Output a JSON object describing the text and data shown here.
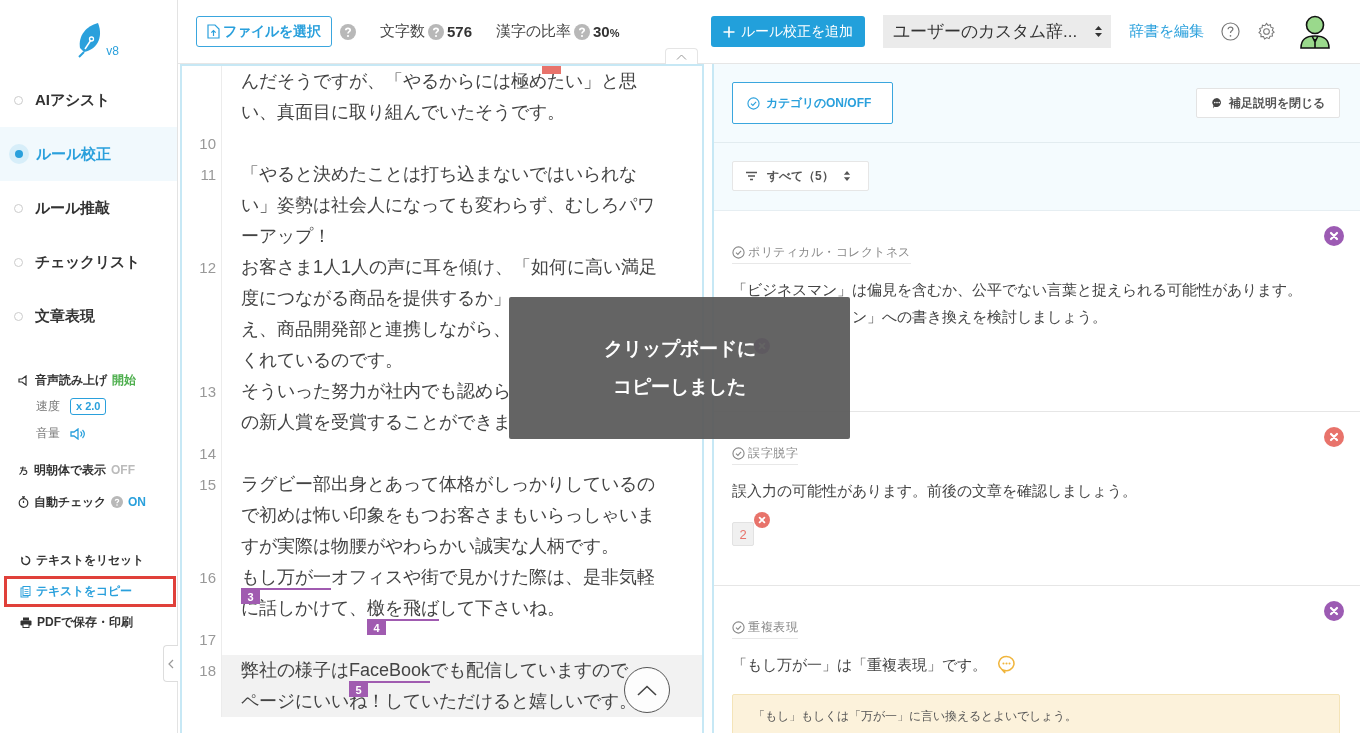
{
  "logo": {
    "version": "v8"
  },
  "nav": [
    {
      "label": "AIアシスト",
      "selected": false
    },
    {
      "label": "ルール校正",
      "selected": true
    },
    {
      "label": "ルール推敲",
      "selected": false
    },
    {
      "label": "チェックリスト",
      "selected": false
    },
    {
      "label": "文章表現",
      "selected": false
    }
  ],
  "speech": {
    "label": "音声読み上げ",
    "action": "開始",
    "speed_label": "速度",
    "speed": "x 2.0",
    "volume_label": "音量"
  },
  "toggles": [
    {
      "kind": "font",
      "label": "明朝体で表示",
      "value": "OFF",
      "on": false
    },
    {
      "kind": "timer",
      "label": "自動チェック",
      "value": "ON",
      "on": true,
      "help": true
    }
  ],
  "actions": [
    {
      "kind": "reset",
      "label": "テキストをリセット",
      "highlighted": false
    },
    {
      "kind": "copy",
      "label": "テキストをコピー",
      "highlighted": true
    },
    {
      "kind": "print",
      "label": "PDFで保存・印刷",
      "highlighted": false
    }
  ],
  "header": {
    "file_button": "ファイルを選択",
    "stats": [
      {
        "label": "文字数",
        "value": "576"
      },
      {
        "label": "漢字の比率",
        "value": "30",
        "unit": "%"
      }
    ],
    "add_button": "ルール校正を追加",
    "dictionary": "ユーザーのカスタム辞...",
    "edit_link": "辞書を編集"
  },
  "editor": {
    "cut_badge": {
      "color": "#e8736b"
    },
    "lines": [
      {
        "current": false,
        "rows": [
          [
            {
              "text": "んだそうですが、「やるからには極めたい」と思"
            }
          ],
          [
            {
              "text": "い、真面目に取り組んでいたそうです。"
            }
          ]
        ]
      },
      {
        "number": "10",
        "current": false
      },
      {
        "number": "11",
        "current": false,
        "rows": [
          [
            {
              "text": "「やると決めたことは打ち込まないではいられな"
            }
          ],
          [
            {
              "text": "い」姿勢は社会人になっても変わらず、むしろパワ"
            }
          ],
          [
            {
              "text": "ーアップ！"
            }
          ]
        ]
      },
      {
        "number": "12",
        "current": false,
        "rows": [
          [
            {
              "text": "お客さま1人1人の声に耳を傾け、「如何に高い満足"
            }
          ],
          [
            {
              "text": "度につながる商品を提供するか」"
            }
          ],
          [
            {
              "text": "え、商品開発部と連携しながら、"
            }
          ],
          [
            {
              "text": "くれているのです。"
            }
          ]
        ]
      },
      {
        "number": "13",
        "current": false,
        "rows": [
          [
            {
              "text": "そういった努力が社内でも認めら"
            }
          ],
          [
            {
              "text": "の新人賞を受賞することができま"
            }
          ]
        ]
      },
      {
        "number": "14",
        "current": false
      },
      {
        "number": "15",
        "current": false,
        "rows": [
          [
            {
              "text": "ラグビー部出身とあって体格がしっかりしているの"
            }
          ],
          [
            {
              "text": "で初めは怖い印象をもつお客さまもいらっしゃいま"
            }
          ],
          [
            {
              "text": "すが実際は物腰がやわらかい誠実な人柄です。"
            }
          ]
        ]
      },
      {
        "number": "16",
        "current": false,
        "rows": [
          [
            {
              "text": "もし万が一",
              "mark": "3",
              "color": "#a05bb0"
            },
            {
              "text": "オフィスや街で見かけた際は、是非気軽"
            }
          ],
          [
            {
              "text": "に話しかけて、"
            },
            {
              "text": "檄を飛ば",
              "mark": "4",
              "color": "#a05bb0"
            },
            {
              "text": "して下さいね。"
            }
          ]
        ]
      },
      {
        "number": "17",
        "current": false
      },
      {
        "number": "18",
        "current": true,
        "rows": [
          [
            {
              "text": "弊社の様子は"
            },
            {
              "text": "FaceBook",
              "mark": "5",
              "color": "#a05bb0"
            },
            {
              "text": "でも配信していますので"
            }
          ],
          [
            {
              "text": "ページにいいね！していただけると嬉しいです。"
            }
          ]
        ]
      }
    ]
  },
  "toast": {
    "lines": [
      "クリップボードに",
      "コピーしました"
    ]
  },
  "panel": {
    "category_button": "カテゴリのON/OFF",
    "note_button": "補足説明を閉じる",
    "filter": "すべて（5）",
    "cards": [
      {
        "category": "ポリティカル・コレクトネス",
        "color": "#9c5bb3",
        "message": [
          {
            "text": "「ビジネスマン」は偏見を含むか、公平でない言葉と捉えられる可能性があります。",
            "covered": false
          },
          {
            "text": "ン」への書き換えを検討しましょう。",
            "covered": true
          }
        ],
        "chip": {
          "kind": "covered"
        }
      },
      {
        "category": "誤字脱字",
        "color": "#e8736b",
        "message": [
          {
            "text": "誤入力の可能性があります。前後の文章を確認しましょう。",
            "covered": false
          }
        ],
        "chip": {
          "kind": "number",
          "label": "2"
        }
      },
      {
        "category": "重複表現",
        "color": "#9c5bb3",
        "message": [
          {
            "text": "「もし万が一」は「重複表現」です。",
            "covered": false
          }
        ],
        "info": true,
        "tip": "「もし」もしくは「万が一」に言い換えるとよいでしょう。"
      }
    ]
  }
}
